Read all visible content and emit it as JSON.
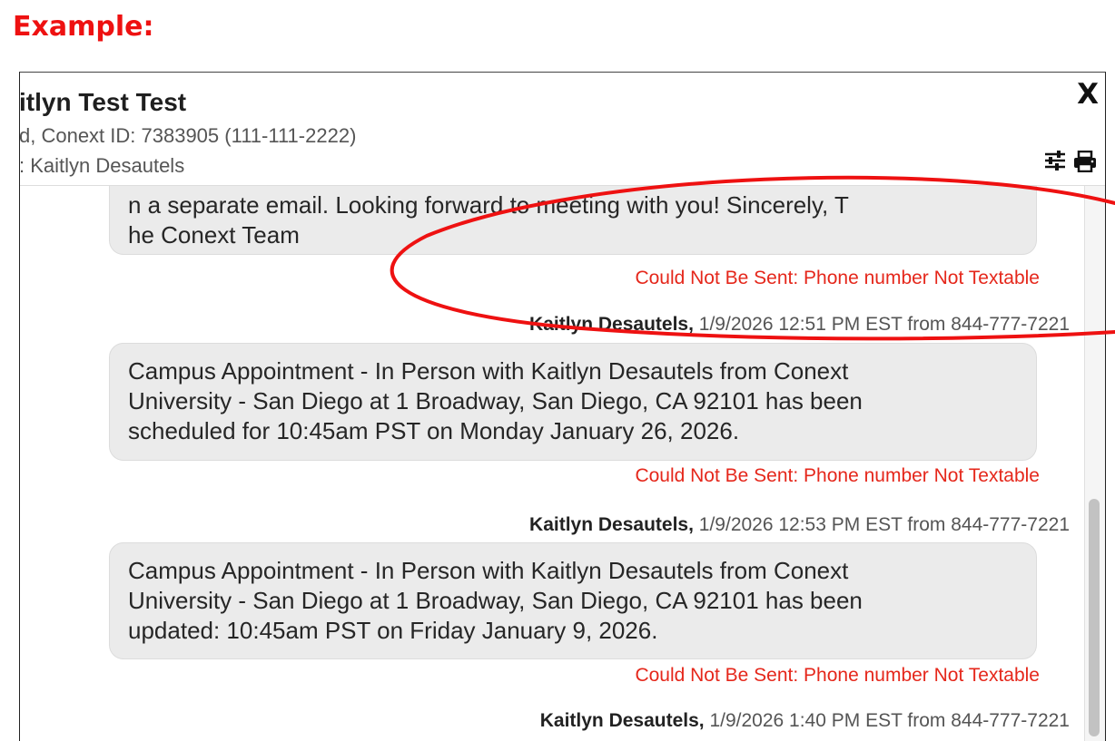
{
  "example_label": "Example:",
  "contact": {
    "name": "itlyn Test Test",
    "line1": "d, Conext ID: 7383905 (111-111-2222)",
    "line2": ": Kaitlyn Desautels"
  },
  "header": {
    "close_label": "X",
    "filter_icon": "sliders-icon",
    "print_icon": "printer-icon"
  },
  "messages": [
    {
      "text": "n a separate email. Looking forward to meeting with you! Sincerely, T\nhe Conext Team",
      "status": "Could Not Be Sent: Phone number Not Textable"
    },
    {
      "sender": "Kaitlyn Desautels,",
      "meta": " 1/9/2026 12:51 PM EST from 844-777-7221",
      "text": "Campus Appointment - In Person with Kaitlyn Desautels from Conext\nUniversity - San Diego at 1 Broadway, San Diego, CA 92101 has been\nscheduled for 10:45am PST on Monday January 26, 2026.",
      "status": "Could Not Be Sent: Phone number Not Textable"
    },
    {
      "sender": "Kaitlyn Desautels,",
      "meta": " 1/9/2026 12:53 PM EST from 844-777-7221",
      "text": "Campus Appointment - In Person with Kaitlyn Desautels from Conext\nUniversity - San Diego at 1 Broadway, San Diego, CA 92101 has been\nupdated: 10:45am PST on Friday January 9, 2026.",
      "status": "Could Not Be Sent: Phone number Not Textable"
    },
    {
      "sender": "Kaitlyn Desautels,",
      "meta": " 1/9/2026 1:40 PM EST from 844-777-7221"
    }
  ],
  "colors": {
    "accent_red": "#e5271b",
    "bubble_bg": "#ebebeb",
    "annotation_red": "#ee1111"
  }
}
